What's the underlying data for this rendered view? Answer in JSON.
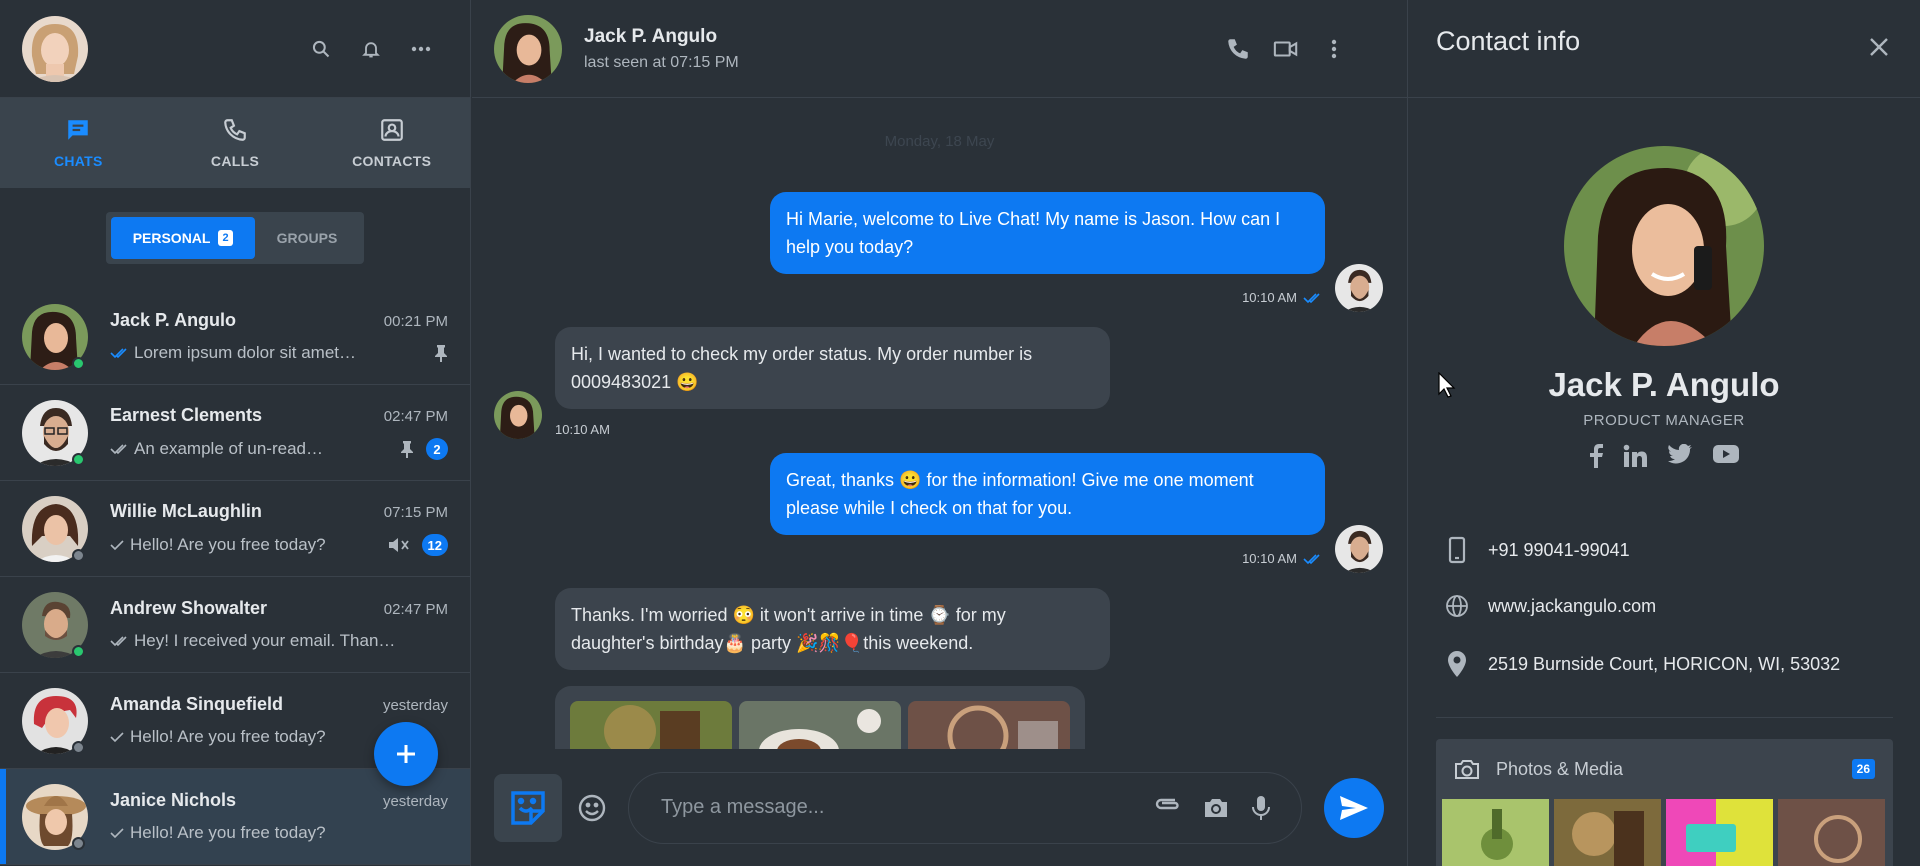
{
  "sidebar": {
    "nav": [
      {
        "label": "CHATS",
        "icon": "chat-icon"
      },
      {
        "label": "CALLS",
        "icon": "phone-icon"
      },
      {
        "label": "CONTACTS",
        "icon": "contacts-icon"
      }
    ],
    "segments": {
      "personal": "PERSONAL",
      "personal_count": "2",
      "groups": "GROUPS"
    },
    "chats": [
      {
        "name": "Jack P. Angulo",
        "time": "00:21 PM",
        "message": "Lorem ipsum dolor sit amet…",
        "status": "online",
        "tick": "read",
        "pinned": true
      },
      {
        "name": "Earnest Clements",
        "time": "02:47 PM",
        "message": "An example of un-read…",
        "status": "online",
        "tick": "delivered",
        "pinned": true,
        "unread": "2"
      },
      {
        "name": "Willie McLaughlin",
        "time": "07:15 PM",
        "message": "Hello! Are you free today?",
        "status": "offline",
        "tick": "sent",
        "muted": true,
        "unread": "12"
      },
      {
        "name": "Andrew Showalter",
        "time": "02:47 PM",
        "message": "Hey! I received your email. Than…",
        "status": "online",
        "tick": "delivered"
      },
      {
        "name": "Amanda Sinquefield",
        "time": "yesterday",
        "message": "Hello! Are you free today?",
        "status": "offline",
        "tick": "sent"
      },
      {
        "name": "Janice Nichols",
        "time": "yesterday",
        "message": "Hello! Are you free today?",
        "status": "offline",
        "tick": "sent"
      }
    ]
  },
  "chat": {
    "header": {
      "name": "Jack P. Angulo",
      "status": "last seen at 07:15 PM"
    },
    "date_separator": "Monday, 18 May",
    "messages": [
      {
        "dir": "out",
        "text": "Hi Marie, welcome to Live Chat! My name is Jason. How can I help you today?",
        "time": "10:10 AM"
      },
      {
        "dir": "in",
        "text": "Hi, I wanted to check my order status. My order number is 0009483021 😀",
        "time": "10:10 AM"
      },
      {
        "dir": "out",
        "text": "Great, thanks 😀 for the information! Give me one moment please while I check on that for you.",
        "time": "10:10 AM"
      },
      {
        "dir": "in",
        "text": "Thanks. I'm worried 😳 it won't arrive in time ⌚ for my daughter's birthday🎂 party 🎉🎊🎈this weekend."
      }
    ],
    "composer": {
      "placeholder": "Type a message..."
    }
  },
  "contact": {
    "title": "Contact info",
    "name": "Jack P. Angulo",
    "role": "PRODUCT MANAGER",
    "phone": "+91 99041-99041",
    "website": "www.jackangulo.com",
    "address": "2519 Burnside Court, HORICON, WI, 53032",
    "media_label": "Photos & Media",
    "media_count": "26"
  },
  "colors": {
    "accent": "#0d79f2",
    "background": "#2a3138",
    "panel": "#3a444d",
    "online": "#29c76f"
  }
}
